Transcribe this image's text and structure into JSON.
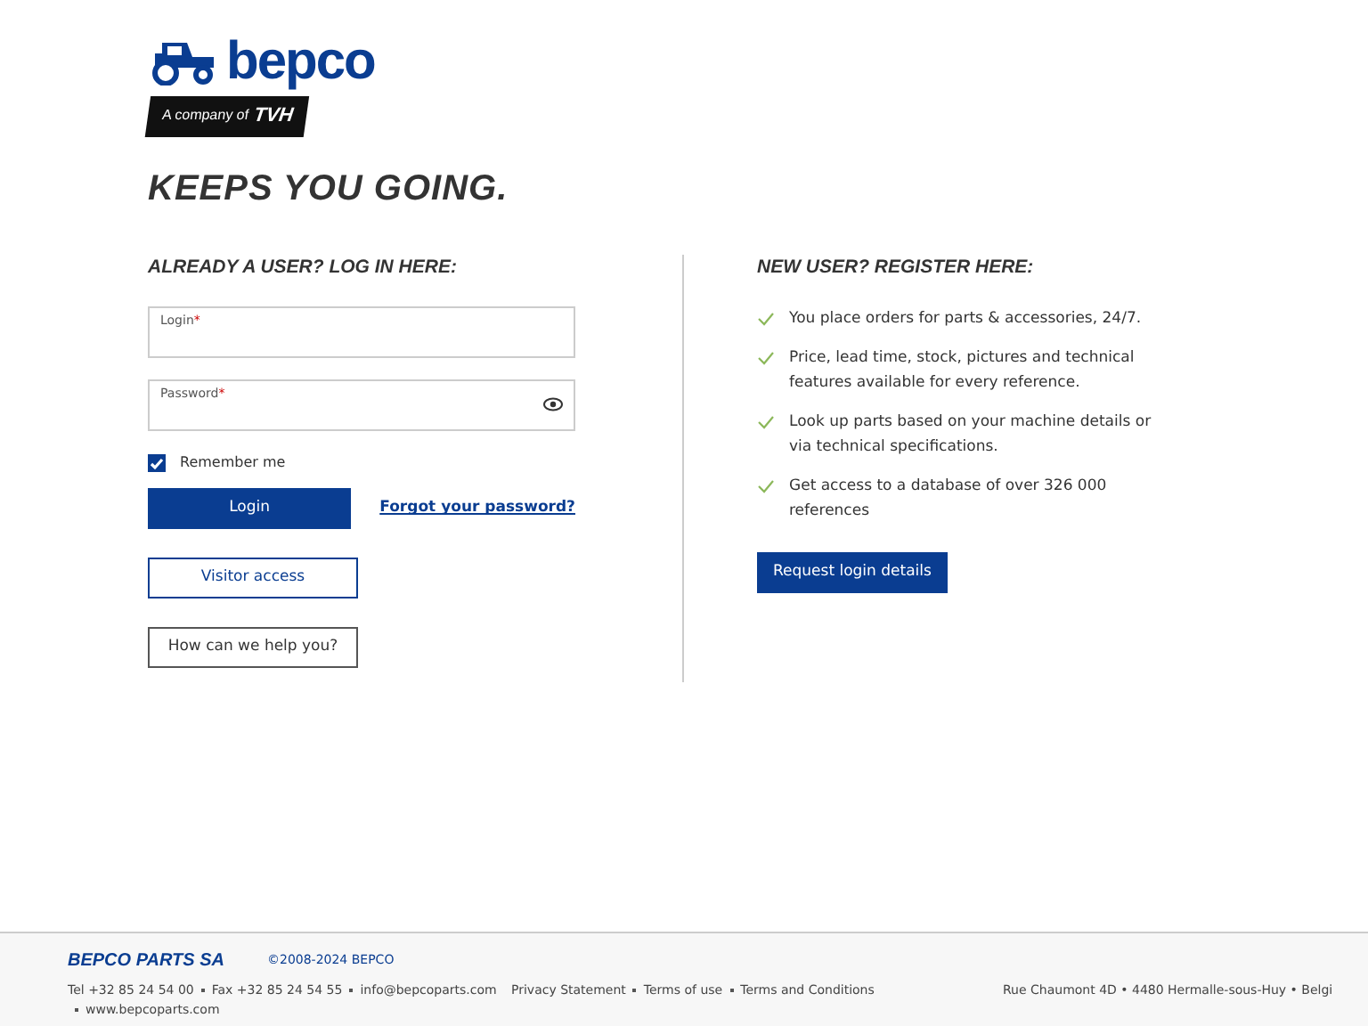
{
  "logo": {
    "brand": "bepco",
    "tagline_prefix": "A company of",
    "tagline_brand": "TVH"
  },
  "slogan": "KEEPS YOU GOING.",
  "login": {
    "heading": "ALREADY A USER? LOG IN HERE:",
    "fields": [
      {
        "label": "Login",
        "required_mark": "*",
        "kind": "text"
      },
      {
        "label": "Password",
        "required_mark": "*",
        "kind": "password"
      }
    ],
    "remember": {
      "label": "Remember me",
      "checked": true
    },
    "login_button": "Login",
    "forgot_link": "Forgot your password?",
    "buttons": [
      "Visitor access",
      "How can we help you?"
    ]
  },
  "register": {
    "heading": "NEW USER? REGISTER HERE:",
    "benefits": [
      "You place orders for parts & accessories, 24/7.",
      "Price, lead time, stock, pictures and technical features available for every reference.",
      "Look up parts based on your machine details or via technical specifications.",
      "Get access to a database of over 326 000 references"
    ],
    "button": "Request login details"
  },
  "footer": {
    "company": "BEPCO PARTS SA",
    "copyright": "©2008-2024 BEPCO",
    "contacts": [
      "Tel +32 85 24 54 00",
      "Fax +32 85 24 54 55",
      "info@bepcoparts.com",
      "www.bepcoparts.com"
    ],
    "links": [
      "Privacy Statement",
      "Terms of use",
      "Terms and Conditions"
    ],
    "address": "Rue Chaumont 4D • 4480 Hermalle-sous-Huy • Belgi"
  }
}
